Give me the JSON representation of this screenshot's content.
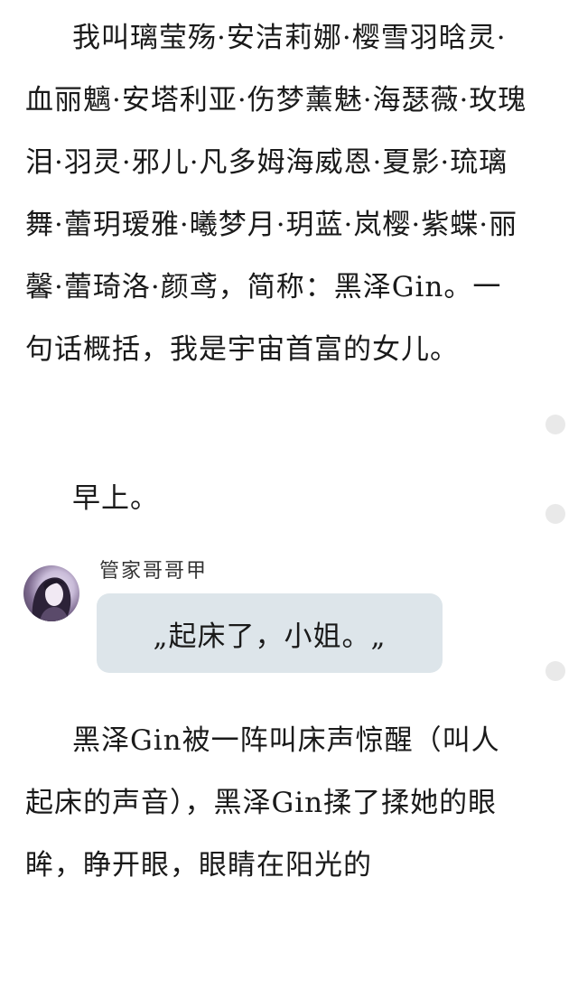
{
  "story": {
    "intro": "我叫璃莹殇·安洁莉娜·樱雪羽晗灵·血丽魑·安塔利亚·伤梦薰魅·海瑟薇·玫瑰泪·羽灵·邪儿·凡多姆海威恩·夏影·琉璃舞·蕾玥瑷雅·曦梦月·玥蓝·岚樱·紫蝶·丽馨·蕾琦洛·颜鸢，简称：黑泽Gin。一句话概括，我是宇宙首富的女儿。",
    "morning": "早上。",
    "wake": "黑泽Gin被一阵叫床声惊醒（叫人起床的声音），黑泽Gin揉了揉她的眼眸，睁开眼，眼睛在阳光的"
  },
  "dialogue": {
    "speaker": "管家哥哥甲",
    "text": "„起床了，小姐。„",
    "bubble_color": "#dde5ea"
  },
  "colors": {
    "background": "#ffffff",
    "text": "#1a1a1a",
    "dot": "#e9e9e9"
  }
}
